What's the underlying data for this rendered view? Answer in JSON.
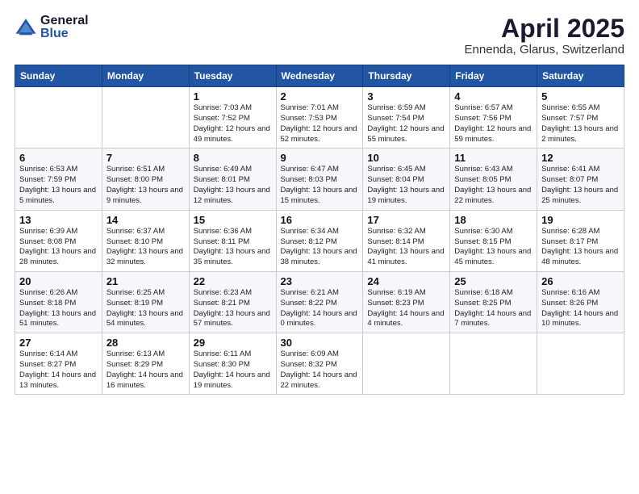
{
  "logo": {
    "general": "General",
    "blue": "Blue"
  },
  "title": "April 2025",
  "subtitle": "Ennenda, Glarus, Switzerland",
  "days_of_week": [
    "Sunday",
    "Monday",
    "Tuesday",
    "Wednesday",
    "Thursday",
    "Friday",
    "Saturday"
  ],
  "weeks": [
    [
      {
        "day": "",
        "info": ""
      },
      {
        "day": "",
        "info": ""
      },
      {
        "day": "1",
        "info": "Sunrise: 7:03 AM\nSunset: 7:52 PM\nDaylight: 12 hours and 49 minutes."
      },
      {
        "day": "2",
        "info": "Sunrise: 7:01 AM\nSunset: 7:53 PM\nDaylight: 12 hours and 52 minutes."
      },
      {
        "day": "3",
        "info": "Sunrise: 6:59 AM\nSunset: 7:54 PM\nDaylight: 12 hours and 55 minutes."
      },
      {
        "day": "4",
        "info": "Sunrise: 6:57 AM\nSunset: 7:56 PM\nDaylight: 12 hours and 59 minutes."
      },
      {
        "day": "5",
        "info": "Sunrise: 6:55 AM\nSunset: 7:57 PM\nDaylight: 13 hours and 2 minutes."
      }
    ],
    [
      {
        "day": "6",
        "info": "Sunrise: 6:53 AM\nSunset: 7:59 PM\nDaylight: 13 hours and 5 minutes."
      },
      {
        "day": "7",
        "info": "Sunrise: 6:51 AM\nSunset: 8:00 PM\nDaylight: 13 hours and 9 minutes."
      },
      {
        "day": "8",
        "info": "Sunrise: 6:49 AM\nSunset: 8:01 PM\nDaylight: 13 hours and 12 minutes."
      },
      {
        "day": "9",
        "info": "Sunrise: 6:47 AM\nSunset: 8:03 PM\nDaylight: 13 hours and 15 minutes."
      },
      {
        "day": "10",
        "info": "Sunrise: 6:45 AM\nSunset: 8:04 PM\nDaylight: 13 hours and 19 minutes."
      },
      {
        "day": "11",
        "info": "Sunrise: 6:43 AM\nSunset: 8:05 PM\nDaylight: 13 hours and 22 minutes."
      },
      {
        "day": "12",
        "info": "Sunrise: 6:41 AM\nSunset: 8:07 PM\nDaylight: 13 hours and 25 minutes."
      }
    ],
    [
      {
        "day": "13",
        "info": "Sunrise: 6:39 AM\nSunset: 8:08 PM\nDaylight: 13 hours and 28 minutes."
      },
      {
        "day": "14",
        "info": "Sunrise: 6:37 AM\nSunset: 8:10 PM\nDaylight: 13 hours and 32 minutes."
      },
      {
        "day": "15",
        "info": "Sunrise: 6:36 AM\nSunset: 8:11 PM\nDaylight: 13 hours and 35 minutes."
      },
      {
        "day": "16",
        "info": "Sunrise: 6:34 AM\nSunset: 8:12 PM\nDaylight: 13 hours and 38 minutes."
      },
      {
        "day": "17",
        "info": "Sunrise: 6:32 AM\nSunset: 8:14 PM\nDaylight: 13 hours and 41 minutes."
      },
      {
        "day": "18",
        "info": "Sunrise: 6:30 AM\nSunset: 8:15 PM\nDaylight: 13 hours and 45 minutes."
      },
      {
        "day": "19",
        "info": "Sunrise: 6:28 AM\nSunset: 8:17 PM\nDaylight: 13 hours and 48 minutes."
      }
    ],
    [
      {
        "day": "20",
        "info": "Sunrise: 6:26 AM\nSunset: 8:18 PM\nDaylight: 13 hours and 51 minutes."
      },
      {
        "day": "21",
        "info": "Sunrise: 6:25 AM\nSunset: 8:19 PM\nDaylight: 13 hours and 54 minutes."
      },
      {
        "day": "22",
        "info": "Sunrise: 6:23 AM\nSunset: 8:21 PM\nDaylight: 13 hours and 57 minutes."
      },
      {
        "day": "23",
        "info": "Sunrise: 6:21 AM\nSunset: 8:22 PM\nDaylight: 14 hours and 0 minutes."
      },
      {
        "day": "24",
        "info": "Sunrise: 6:19 AM\nSunset: 8:23 PM\nDaylight: 14 hours and 4 minutes."
      },
      {
        "day": "25",
        "info": "Sunrise: 6:18 AM\nSunset: 8:25 PM\nDaylight: 14 hours and 7 minutes."
      },
      {
        "day": "26",
        "info": "Sunrise: 6:16 AM\nSunset: 8:26 PM\nDaylight: 14 hours and 10 minutes."
      }
    ],
    [
      {
        "day": "27",
        "info": "Sunrise: 6:14 AM\nSunset: 8:27 PM\nDaylight: 14 hours and 13 minutes."
      },
      {
        "day": "28",
        "info": "Sunrise: 6:13 AM\nSunset: 8:29 PM\nDaylight: 14 hours and 16 minutes."
      },
      {
        "day": "29",
        "info": "Sunrise: 6:11 AM\nSunset: 8:30 PM\nDaylight: 14 hours and 19 minutes."
      },
      {
        "day": "30",
        "info": "Sunrise: 6:09 AM\nSunset: 8:32 PM\nDaylight: 14 hours and 22 minutes."
      },
      {
        "day": "",
        "info": ""
      },
      {
        "day": "",
        "info": ""
      },
      {
        "day": "",
        "info": ""
      }
    ]
  ]
}
